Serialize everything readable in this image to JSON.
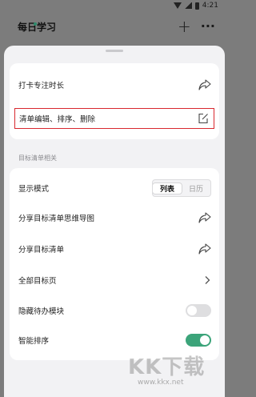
{
  "status_bar": {
    "time": "4:21"
  },
  "app_bar": {
    "title": "每日学习"
  },
  "sheet": {
    "top_card": {
      "rows": [
        {
          "label": "打卡专注时长",
          "icon": "share-icon"
        },
        {
          "label": "清单编辑、排序、删除",
          "icon": "edit-icon",
          "highlighted": true
        }
      ]
    },
    "section_title": "目标清单相关",
    "display_mode": {
      "label": "显示模式",
      "options": [
        "列表",
        "日历"
      ],
      "selected": "列表"
    },
    "rows": [
      {
        "label": "分享目标清单思维导图",
        "icon": "share-icon"
      },
      {
        "label": "分享目标清单",
        "icon": "share-icon"
      },
      {
        "label": "全部目标页",
        "icon": "chevron-right-icon"
      },
      {
        "label": "隐藏待办模块",
        "toggle": false
      },
      {
        "label": "智能排序",
        "toggle": true
      }
    ]
  },
  "watermark": {
    "text": "KK下载",
    "url": "www.kkx.net"
  },
  "colors": {
    "accent": "#3ca47a",
    "highlight_border": "#d8282f",
    "sheet_bg": "#f2f2f4"
  }
}
